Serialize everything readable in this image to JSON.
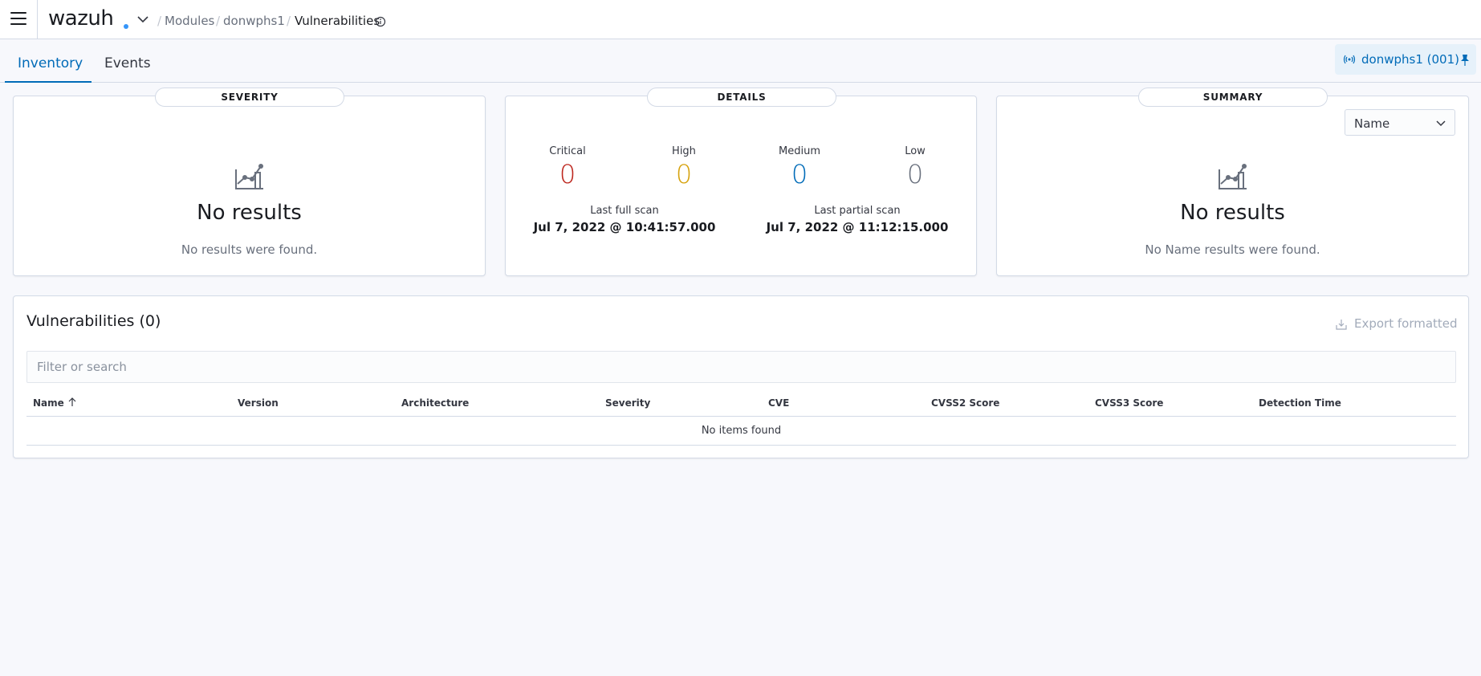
{
  "header": {
    "logo": "wazuh",
    "breadcrumbs": [
      "Modules",
      "donwphs1",
      "Vulnerabilities"
    ]
  },
  "tabs": [
    "Inventory",
    "Events"
  ],
  "agent": {
    "label": "donwphs1 (001)"
  },
  "severity_panel": {
    "title": "SEVERITY",
    "empty_title": "No results",
    "empty_body": "No results were found."
  },
  "details_panel": {
    "title": "DETAILS",
    "stats": [
      {
        "label": "Critical",
        "value": "0",
        "color": "#bd271e"
      },
      {
        "label": "High",
        "value": "0",
        "color": "#d6a20d"
      },
      {
        "label": "Medium",
        "value": "0",
        "color": "#006bb8"
      },
      {
        "label": "Low",
        "value": "0",
        "color": "#69707d"
      }
    ],
    "last_full_scan_label": "Last full scan",
    "last_full_scan_value": "Jul 7, 2022 @ 10:41:57.000",
    "last_partial_scan_label": "Last partial scan",
    "last_partial_scan_value": "Jul 7, 2022 @ 11:12:15.000"
  },
  "summary_panel": {
    "title": "SUMMARY",
    "select_value": "Name",
    "empty_title": "No results",
    "empty_body": "No Name results were found."
  },
  "vulnerabilities": {
    "title": "Vulnerabilities (0)",
    "export_label": "Export formatted",
    "search_placeholder": "Filter or search",
    "columns": [
      "Name",
      "Version",
      "Architecture",
      "Severity",
      "CVE",
      "CVSS2 Score",
      "CVSS3 Score",
      "Detection Time"
    ],
    "empty_message": "No items found"
  },
  "colors": {
    "accent": "#006bb8",
    "agent_bg": "#e6f1fa"
  }
}
